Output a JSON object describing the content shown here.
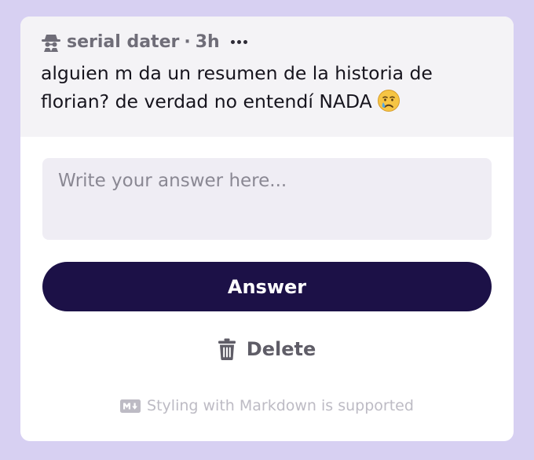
{
  "question": {
    "author": "serial dater",
    "separator": "·",
    "time": "3h",
    "text": "alguien m da un resumen de la historia de florian? de verdad no entendí NADA",
    "author_icon": "spy-icon",
    "emoji": "crying-face-emoji",
    "more_icon": "more-options-icon"
  },
  "answer": {
    "placeholder": "Write your answer here...",
    "value": "",
    "button_label": "Answer",
    "button_color": "#1c1147"
  },
  "delete": {
    "label": "Delete",
    "icon": "trash-icon"
  },
  "markdown_note": {
    "text": "Styling with Markdown is supported",
    "icon": "markdown-icon"
  },
  "colors": {
    "background": "#d7d0f2",
    "card": "#ffffff",
    "question_bg": "#f4f3f6",
    "input_bg": "#efedf4"
  }
}
